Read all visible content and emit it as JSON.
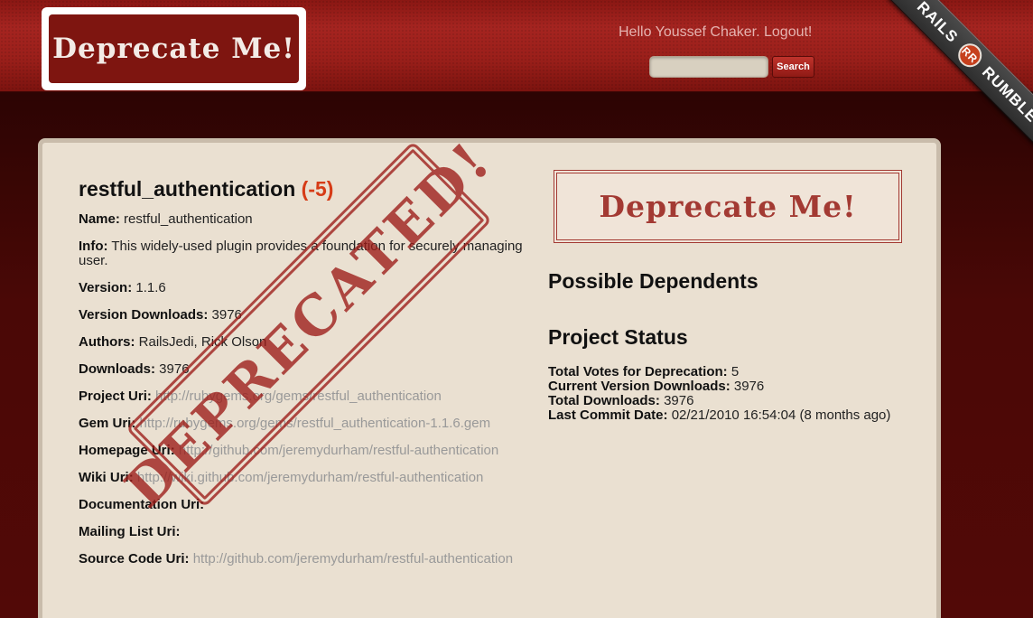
{
  "header": {
    "logo_text": "Deprecate Me!",
    "greeting": "Hello Youssef Chaker. Logout!",
    "search_placeholder": "",
    "search_button": "Search",
    "ribbon": {
      "left": "RAILS",
      "badge": "RR",
      "right": "RUMBLE"
    }
  },
  "project": {
    "title": "restful_authentication",
    "score": "(-5)",
    "stamp_text": "DEPRECATED!",
    "fields": [
      {
        "label": "Name:",
        "value": "restful_authentication",
        "is_link": false
      },
      {
        "label": "Info:",
        "value": "This widely-used plugin provides a foundation for securely managing user.",
        "is_link": false
      },
      {
        "label": "Version:",
        "value": "1.1.6",
        "is_link": false
      },
      {
        "label": "Version Downloads:",
        "value": "3976",
        "is_link": false
      },
      {
        "label": "Authors:",
        "value": "RailsJedi, Rick Olson",
        "is_link": false
      },
      {
        "label": "Downloads:",
        "value": "3976",
        "is_link": false
      },
      {
        "label": "Project Uri:",
        "value": "http://rubygems.org/gems/restful_authentication",
        "is_link": true
      },
      {
        "label": "Gem Uri:",
        "value": "http://rubygems.org/gems/restful_authentication-1.1.6.gem",
        "is_link": true
      },
      {
        "label": "Homepage Uri:",
        "value": "http://github.com/jeremydurham/restful-authentication",
        "is_link": true
      },
      {
        "label": "Wiki Uri:",
        "value": "http://wiki.github.com/jeremydurham/restful-authentication",
        "is_link": true
      },
      {
        "label": "Documentation Uri:",
        "value": "",
        "is_link": false
      },
      {
        "label": "Mailing List Uri:",
        "value": "",
        "is_link": false
      },
      {
        "label": "Source Code Uri:",
        "value": "http://github.com/jeremydurham/restful-authentication",
        "is_link": true
      }
    ]
  },
  "sidebar": {
    "logo_text": "Deprecate Me!",
    "possible_dependents_heading": "Possible Dependents",
    "project_status_heading": "Project Status",
    "status": [
      {
        "label": "Total Votes for Deprecation:",
        "value": "5"
      },
      {
        "label": "Current Version Downloads:",
        "value": "3976"
      },
      {
        "label": "Total Downloads:",
        "value": "3976"
      },
      {
        "label": "Last Commit Date:",
        "value": "02/21/2010 16:54:04 (8 months ago)"
      }
    ]
  }
}
